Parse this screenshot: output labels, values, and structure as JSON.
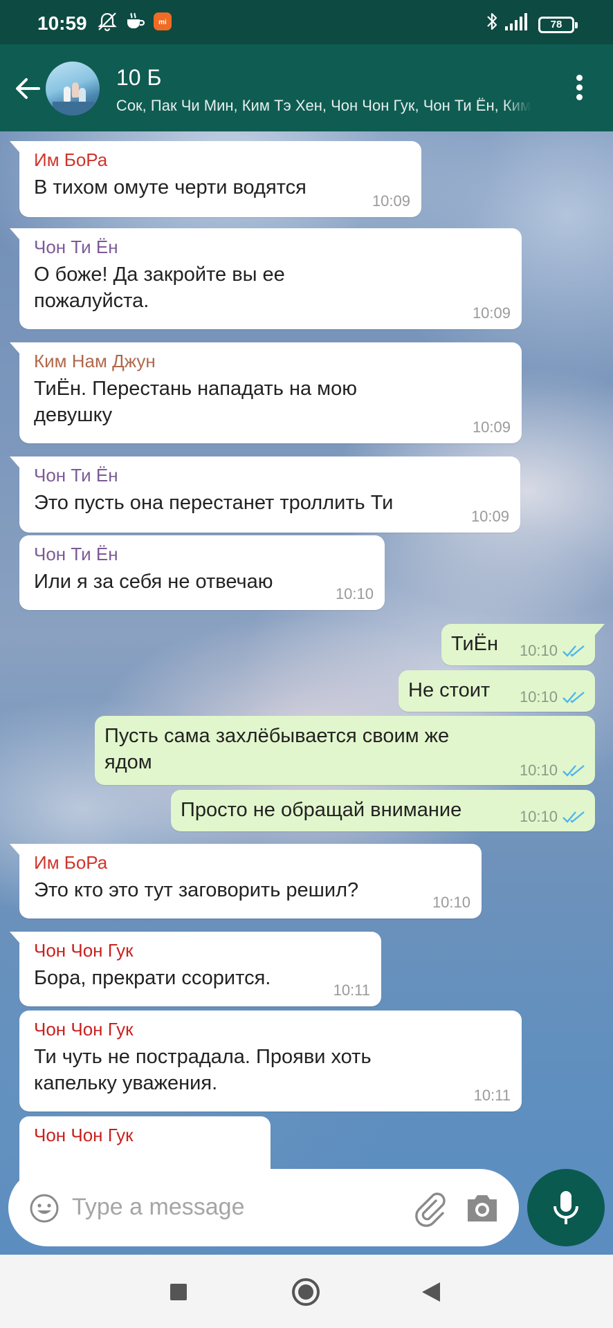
{
  "status_bar": {
    "time": "10:59",
    "battery": "78"
  },
  "header": {
    "title": "10 Б",
    "subtitle": "Чон Хо Сок, Пак Чи Мин, Ким Тэ Хен, Чон Чон Гук, Чон Ти Ён, Ким"
  },
  "messages": [
    {
      "type": "in",
      "sender": "Им БоРа",
      "sender_color": "#d0342c",
      "lines": [
        "В тихом омуте черти водятся"
      ],
      "time": "10:09"
    },
    {
      "type": "in",
      "sender": "Чон Ти Ён",
      "sender_color": "#7c5a97",
      "lines": [
        "О боже! Да закройте вы ее",
        "пожалуйста."
      ],
      "time": "10:09"
    },
    {
      "type": "in",
      "sender": "Ким Нам Джун",
      "sender_color": "#b0684a",
      "lines": [
        "ТиЁн. Перестань нападать на мою",
        "девушку"
      ],
      "time": "10:09"
    },
    {
      "type": "in",
      "sender": "Чон Ти Ён",
      "sender_color": "#7c5a97",
      "lines": [
        "Это пусть она перестанет троллить Ти"
      ],
      "time": "10:09"
    },
    {
      "type": "in",
      "sender": "Чон Ти Ён",
      "sender_color": "#7c5a97",
      "lines": [
        "Или я за себя не отвечаю"
      ],
      "time": "10:10"
    },
    {
      "type": "out",
      "lines": [
        "ТиЁн"
      ],
      "time": "10:10",
      "status": "read"
    },
    {
      "type": "out",
      "lines": [
        "Не стоит"
      ],
      "time": "10:10",
      "status": "read"
    },
    {
      "type": "out",
      "lines": [
        "Пусть сама захлёбывается своим же",
        "ядом"
      ],
      "time": "10:10",
      "status": "read"
    },
    {
      "type": "out",
      "lines": [
        "Просто не обращай внимание"
      ],
      "time": "10:10",
      "status": "read"
    },
    {
      "type": "in",
      "sender": "Им БоРа",
      "sender_color": "#d0342c",
      "lines": [
        "Это кто это тут заговорить решил?"
      ],
      "time": "10:10"
    },
    {
      "type": "in",
      "sender": "Чон Чон Гук",
      "sender_color": "#c9211e",
      "lines": [
        "Бора, прекрати ссорится."
      ],
      "time": "10:11"
    },
    {
      "type": "in",
      "sender": "Чон Чон Гук",
      "sender_color": "#c9211e",
      "lines": [
        "Ти чуть не пострадала. Прояви хоть",
        "капельку уважения."
      ],
      "time": "10:11"
    },
    {
      "type": "in",
      "sender": "Чон Чон Гук",
      "sender_color": "#c9211e",
      "lines": [],
      "time": ""
    }
  ],
  "composer": {
    "placeholder": "Type a message"
  },
  "icons": {
    "status": [
      "silent-bell-icon",
      "coffee-icon",
      "mi-app-icon",
      "bluetooth-icon",
      "signal-icon",
      "battery-icon"
    ],
    "header": [
      "back-arrow-icon",
      "group-avatar",
      "more-vert-icon"
    ],
    "composer": [
      "emoji-icon",
      "attach-clip-icon",
      "camera-icon",
      "mic-icon"
    ],
    "nav": [
      "recents-icon",
      "home-icon",
      "back-icon"
    ]
  },
  "colors": {
    "header": "#0f5c52",
    "status_bar": "#0d4a42",
    "outgoing_bubble": "#e1f6cc",
    "incoming_bubble": "#ffffff",
    "read_tick": "#4fb6ec"
  }
}
